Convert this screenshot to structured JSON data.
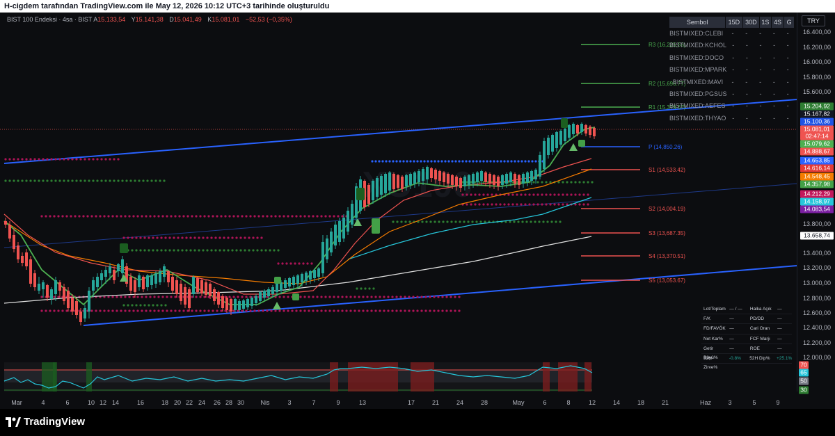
{
  "topbar": {
    "text": "H-cigdem tarafından TradingView.com ile May 12, 2026 10:12 UTC+3 tarihinde oluşturuldu"
  },
  "legend": {
    "symbol": "BIST 100 Endeksi · 4sa · BIST",
    "open_label": "A",
    "open": "15.133,54",
    "high_label": "Y",
    "high": "15.141,38",
    "low_label": "D",
    "low": "15.041,49",
    "close_label": "K",
    "close": "15.081,01",
    "change": "−52,53 (−0,35%)"
  },
  "currency": "TRY",
  "watchlist": {
    "headers": [
      "Sembol",
      "15D",
      "30D",
      "1S",
      "4S",
      "G"
    ],
    "rows": [
      "BISTMIXED:CLEBI",
      "BISTMIXED:KCHOL",
      "BISTMIXED:DOCO",
      "BISTMIXED:MPARK",
      "BISTMIXED:MAVI",
      "BISTMIXED:PGSUS",
      "BISTMIXED:AEFES",
      "BISTMIXED:THYAO"
    ],
    "dash": "-"
  },
  "price_ticks": [
    "16.400,00",
    "16.200,00",
    "16.000,00",
    "15.800,00",
    "15.600,00",
    "13.800,00",
    "13.400,00",
    "13.200,00",
    "13.000,00",
    "12.800,00",
    "12.600,00",
    "12.400,00",
    "12.200,00",
    "12.000,00"
  ],
  "price_badges": [
    {
      "text": "15.204,92",
      "color": "#2e7d32"
    },
    {
      "text": "15.167,82",
      "color": "#131722"
    },
    {
      "text": "15.100,36",
      "color": "#1e53e5"
    },
    {
      "text": "15.081,01",
      "color": "#ef5350"
    },
    {
      "text": "02:47:14",
      "color": "#ef5350"
    },
    {
      "text": "15.079,62",
      "color": "#4caf50"
    },
    {
      "text": "14.888,67",
      "color": "#ef5350"
    },
    {
      "text": "14.653,85",
      "color": "#2962ff"
    },
    {
      "text": "14.616,14",
      "color": "#e53935"
    },
    {
      "text": "14.548,45",
      "color": "#f57c00"
    },
    {
      "text": "14.357,98",
      "color": "#43a047"
    },
    {
      "text": "14.212,29",
      "color": "#c2185b"
    },
    {
      "text": "14.158,97",
      "color": "#26c6da"
    },
    {
      "text": "14.083,54",
      "color": "#7b1fa2"
    },
    {
      "text": "13.658,74",
      "color": "#ffffff"
    }
  ],
  "osc_badges": [
    {
      "text": "70",
      "color": "#ef5350"
    },
    {
      "text": "65",
      "color": "#26c6da"
    },
    {
      "text": "50",
      "color": "#787b86"
    },
    {
      "text": "30",
      "color": "#2e7d32"
    }
  ],
  "pivots": [
    {
      "label": "R3 (16,225.56)",
      "color": "#4caf50"
    },
    {
      "label": "R2 (15,696.77)",
      "color": "#4caf50"
    },
    {
      "label": "R1 (15,379.67)",
      "color": "#4caf50"
    },
    {
      "label": "P (14,850.26)",
      "color": "#2962ff"
    },
    {
      "label": "S1 (14,533.42)",
      "color": "#ef5350"
    },
    {
      "label": "S2 (14,004.19)",
      "color": "#ef5350"
    },
    {
      "label": "S3 (13,687.35)",
      "color": "#ef5350"
    },
    {
      "label": "S4 (13,370.51)",
      "color": "#ef5350"
    },
    {
      "label": "S5 (13,053.67)",
      "color": "#ef5350"
    }
  ],
  "time_labels": [
    "Mar",
    "4",
    "6",
    "10",
    "12",
    "14",
    "16",
    "18",
    "20",
    "22",
    "24",
    "26",
    "28",
    "30",
    "Nis",
    "3",
    "7",
    "9",
    "13",
    "17",
    "21",
    "24",
    "28",
    "May",
    "6",
    "8",
    "12",
    "14",
    "18",
    "21",
    "Haz",
    "3",
    "5",
    "9"
  ],
  "fundamentals": [
    [
      "Lot/Toplam",
      "— / —",
      "Halka Açık",
      "—"
    ],
    [
      "F/K",
      "—",
      "PD/DD",
      "—"
    ],
    [
      "FD/FAVÖK",
      "—",
      "Cari Oran",
      "—"
    ],
    [
      "Net Kar%",
      "—",
      "FCF Marjı",
      "—"
    ],
    [
      "Getir Büyü%",
      "—",
      "ROE",
      "—"
    ],
    [
      "52H Zirve%",
      "-0.8%",
      "52H Dip%",
      "+25.1%"
    ]
  ],
  "watermark": "XU100",
  "brand": "TradingView",
  "colors": {
    "up": "#26a69a",
    "down": "#ef5350",
    "bg": "#0c0d10",
    "blue": "#2962ff"
  }
}
